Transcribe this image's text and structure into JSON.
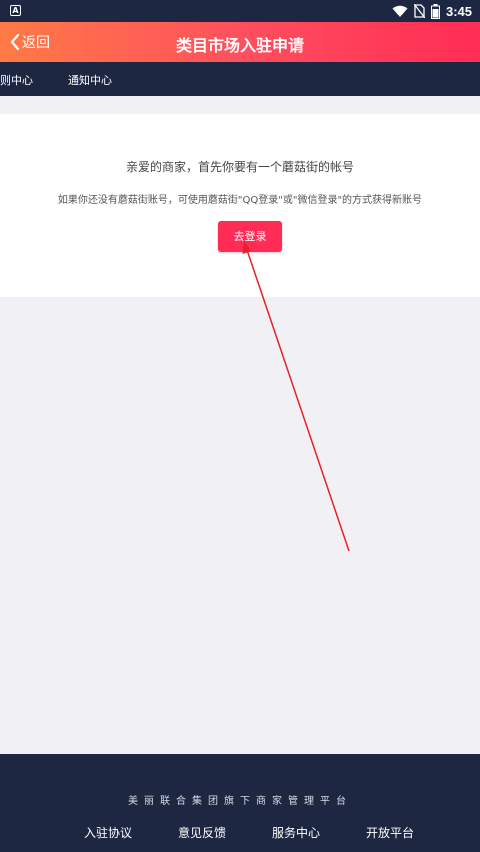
{
  "status_bar": {
    "time": "3:45",
    "app_indicator": "A",
    "icons": [
      "wifi-icon",
      "no-sim-icon",
      "battery-icon"
    ]
  },
  "header": {
    "back_label": "返回",
    "title": "类目市场入驻申请"
  },
  "sub_nav": {
    "items": [
      "则中心",
      "通知中心"
    ]
  },
  "main": {
    "line1": "亲爱的商家，首先你要有一个蘑菇街的帐号",
    "line2": "如果你还没有蘑菇街账号，可使用蘑菇街\"QQ登录\"或\"微信登录\"的方式获得新账号",
    "login_button": "去登录"
  },
  "footer": {
    "slogan": "美丽联合集团旗下商家管理平台",
    "links": [
      "入驻协议",
      "意见反馈",
      "服务中心",
      "开放平台"
    ]
  },
  "colors": {
    "accent": "#ff2d55",
    "header_start": "#ff7a45",
    "nav_dark": "#1e2742",
    "background": "#f1f1f5",
    "annotation_arrow": "#e8202a"
  }
}
